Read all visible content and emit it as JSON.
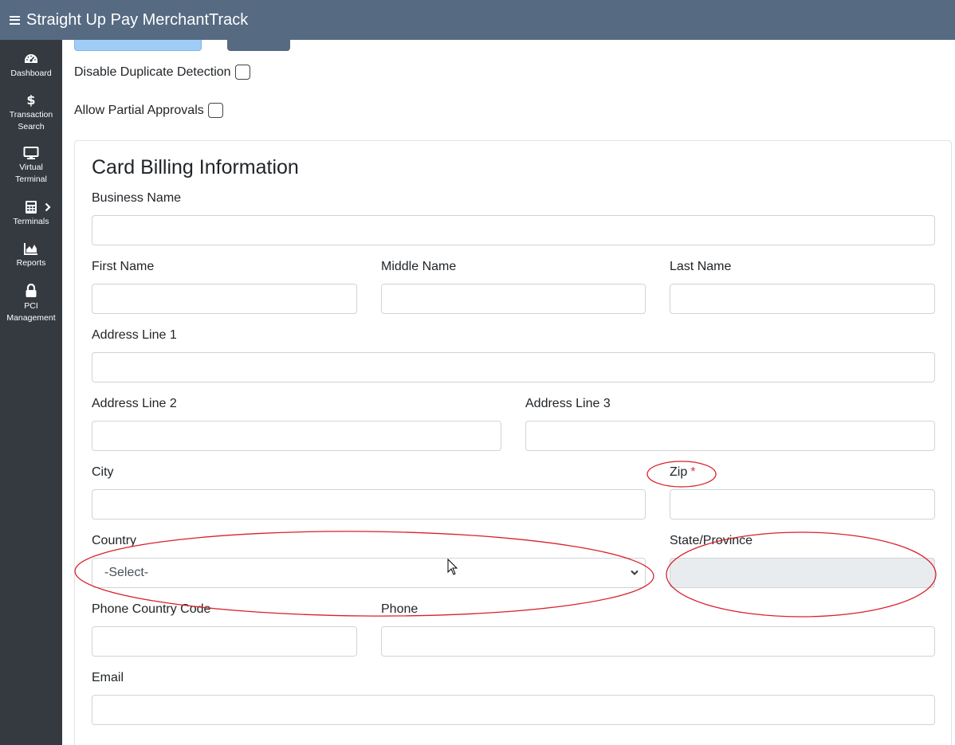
{
  "header": {
    "title": "Straight Up Pay MerchantTrack"
  },
  "sidebar": {
    "items": [
      {
        "label": "Dashboard",
        "icon": "dashboard-gauge-icon"
      },
      {
        "label": "Transaction Search",
        "icon": "dollar-icon"
      },
      {
        "label": "Virtual Terminal",
        "icon": "monitor-icon"
      },
      {
        "label": "Terminals",
        "icon": "calculator-icon"
      },
      {
        "label": "Reports",
        "icon": "area-chart-icon"
      },
      {
        "label": "PCI Management",
        "icon": "lock-icon"
      }
    ]
  },
  "options": {
    "disable_duplicate": "Disable Duplicate Detection",
    "allow_partial": "Allow Partial Approvals"
  },
  "billing": {
    "title": "Card Billing Information",
    "business_name": "Business Name",
    "first_name": "First Name",
    "middle_name": "Middle Name",
    "last_name": "Last Name",
    "address1": "Address Line 1",
    "address2": "Address Line 2",
    "address3": "Address Line 3",
    "city": "City",
    "zip": "Zip",
    "zip_required": "*",
    "country": "Country",
    "country_selected": "-Select-",
    "state": "State/Province",
    "phone_country_code": "Phone Country Code",
    "phone": "Phone",
    "email": "Email"
  },
  "colors": {
    "topbar": "#566a82",
    "sidebar": "#343a40",
    "annotation": "#d9202b",
    "required": "#dc3545"
  }
}
